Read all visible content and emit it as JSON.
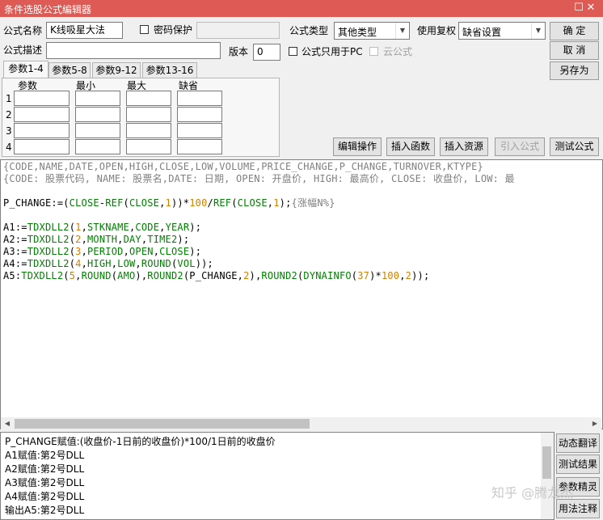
{
  "window": {
    "title": "条件选股公式编辑器",
    "minimize_glyph": "☐",
    "close_glyph": "✕"
  },
  "form": {
    "name_label": "公式名称",
    "name_value": "K线吸星大法",
    "password_label": "密码保护",
    "type_label": "公式类型",
    "type_value": "其他类型",
    "rights_label": "使用复权",
    "rights_value": "缺省设置",
    "desc_label": "公式描述",
    "desc_value": "",
    "version_label": "版本",
    "version_value": "0",
    "pc_only_label": "公式只用于PC",
    "cloud_label": "云公式"
  },
  "buttons": {
    "ok": "确  定",
    "cancel": "取  消",
    "save_as": "另存为"
  },
  "tabs": [
    "参数1-4",
    "参数5-8",
    "参数9-12",
    "参数13-16"
  ],
  "params": {
    "headers": [
      "参数",
      "最小",
      "最大",
      "缺省"
    ],
    "rows": [
      "1",
      "2",
      "3",
      "4"
    ]
  },
  "toolbar": {
    "edit": "编辑操作",
    "insert_func": "插入函数",
    "insert_res": "插入资源",
    "import": "引入公式",
    "test": "测试公式"
  },
  "output": {
    "lines": [
      "P_CHANGE赋值:(收盘价-1日前的收盘价)*100/1日前的收盘价",
      "A1赋值:第2号DLL",
      "A2赋值:第2号DLL",
      "A3赋值:第2号DLL",
      "A4赋值:第2号DLL",
      "输出A5:第2号DLL"
    ]
  },
  "side_buttons": [
    "动态翻译",
    "测试结果",
    "参数精灵",
    "用法注释"
  ],
  "watermark": "知乎 @腾龙杰"
}
